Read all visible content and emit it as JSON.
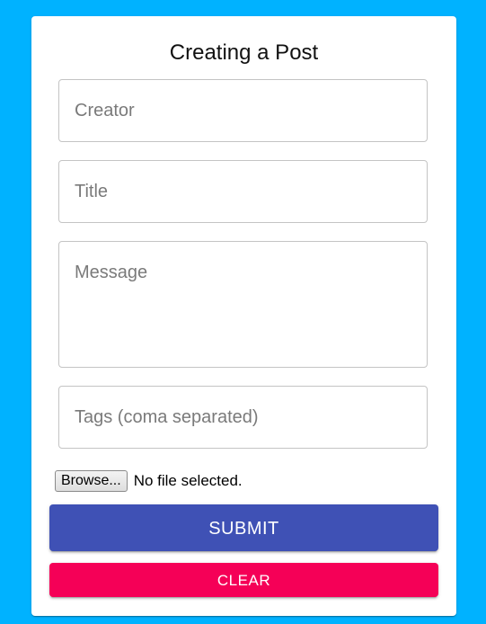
{
  "form": {
    "heading": "Creating a Post",
    "fields": {
      "creator": {
        "placeholder": "Creator",
        "value": ""
      },
      "title": {
        "placeholder": "Title",
        "value": ""
      },
      "message": {
        "placeholder": "Message",
        "value": ""
      },
      "tags": {
        "placeholder": "Tags (coma separated)",
        "value": ""
      }
    },
    "file": {
      "browse_label": "Browse...",
      "status": "No file selected."
    },
    "submit_label": "SUBMIT",
    "clear_label": "CLEAR"
  },
  "colors": {
    "background": "#00b2ff",
    "card": "#ffffff",
    "submit": "#3f51b5",
    "clear": "#f50057"
  }
}
